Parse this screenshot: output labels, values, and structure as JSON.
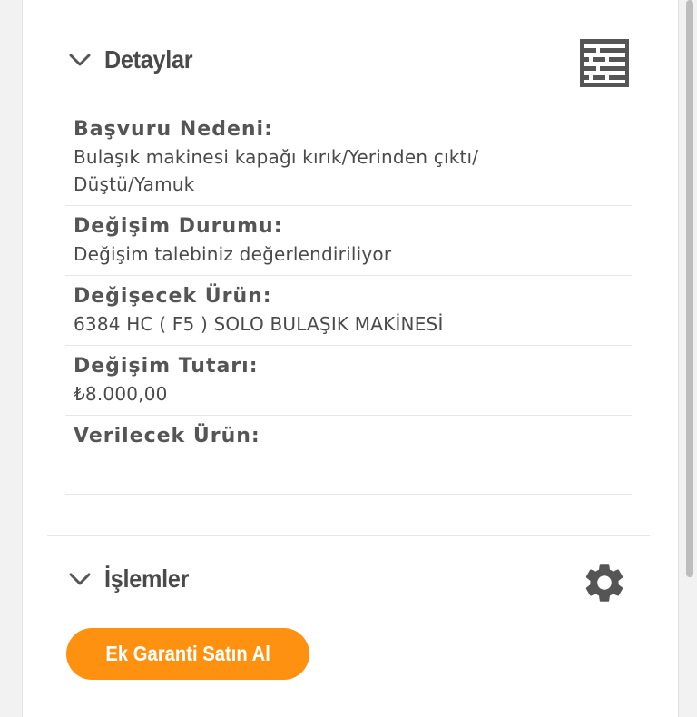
{
  "details_section": {
    "title": "Detaylar",
    "icons": {
      "toggle": "chevron-down-icon",
      "action": "table-grid-icon"
    },
    "rows": [
      {
        "label": "Başvuru Nedeni:",
        "value": "Bulaşık makinesi kapağı kırık/Yerinden çıktı/ Düştü/Yamuk"
      },
      {
        "label": "Değişim Durumu:",
        "value": "Değişim talebiniz değerlendiriliyor"
      },
      {
        "label": "Değişecek Ürün:",
        "value": "6384 HC ( F5 ) SOLO BULAŞIK MAKİNESİ"
      },
      {
        "label": "Değişim Tutarı:",
        "value": "₺8.000,00"
      },
      {
        "label": "Verilecek Ürün:",
        "value": ""
      }
    ]
  },
  "operations_section": {
    "title": "İşlemler",
    "icons": {
      "toggle": "chevron-down-icon",
      "action": "gear-icon"
    },
    "button_label": "Ek Garanti Satın Al"
  },
  "colors": {
    "accent": "#ff9110",
    "icon": "#555555",
    "text": "#3a3a3a"
  }
}
